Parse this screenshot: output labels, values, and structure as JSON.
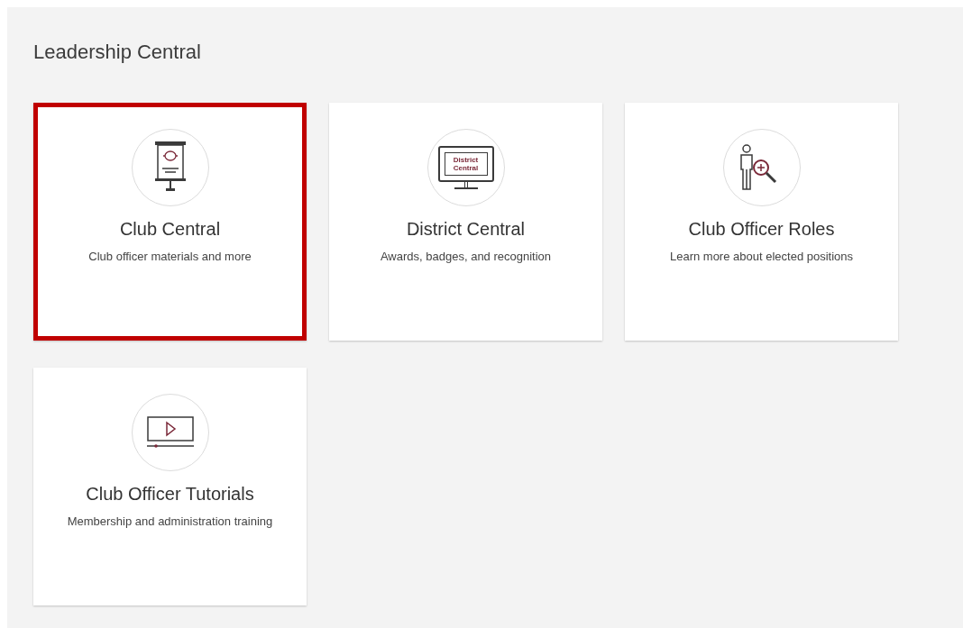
{
  "page_title": "Leadership Central",
  "cards": [
    {
      "kind": "presentation",
      "title": "Club Central",
      "description": "Club officer materials and more",
      "selected": true
    },
    {
      "kind": "monitor",
      "title": "District Central",
      "description": "Awards, badges, and recognition",
      "icon_text": [
        "District",
        "Central"
      ],
      "selected": false
    },
    {
      "kind": "person-search",
      "title": "Club Officer Roles",
      "description": "Learn more about elected positions",
      "selected": false
    },
    {
      "kind": "video",
      "title": "Club Officer Tutorials",
      "description": "Membership and administration training",
      "selected": false
    }
  ]
}
